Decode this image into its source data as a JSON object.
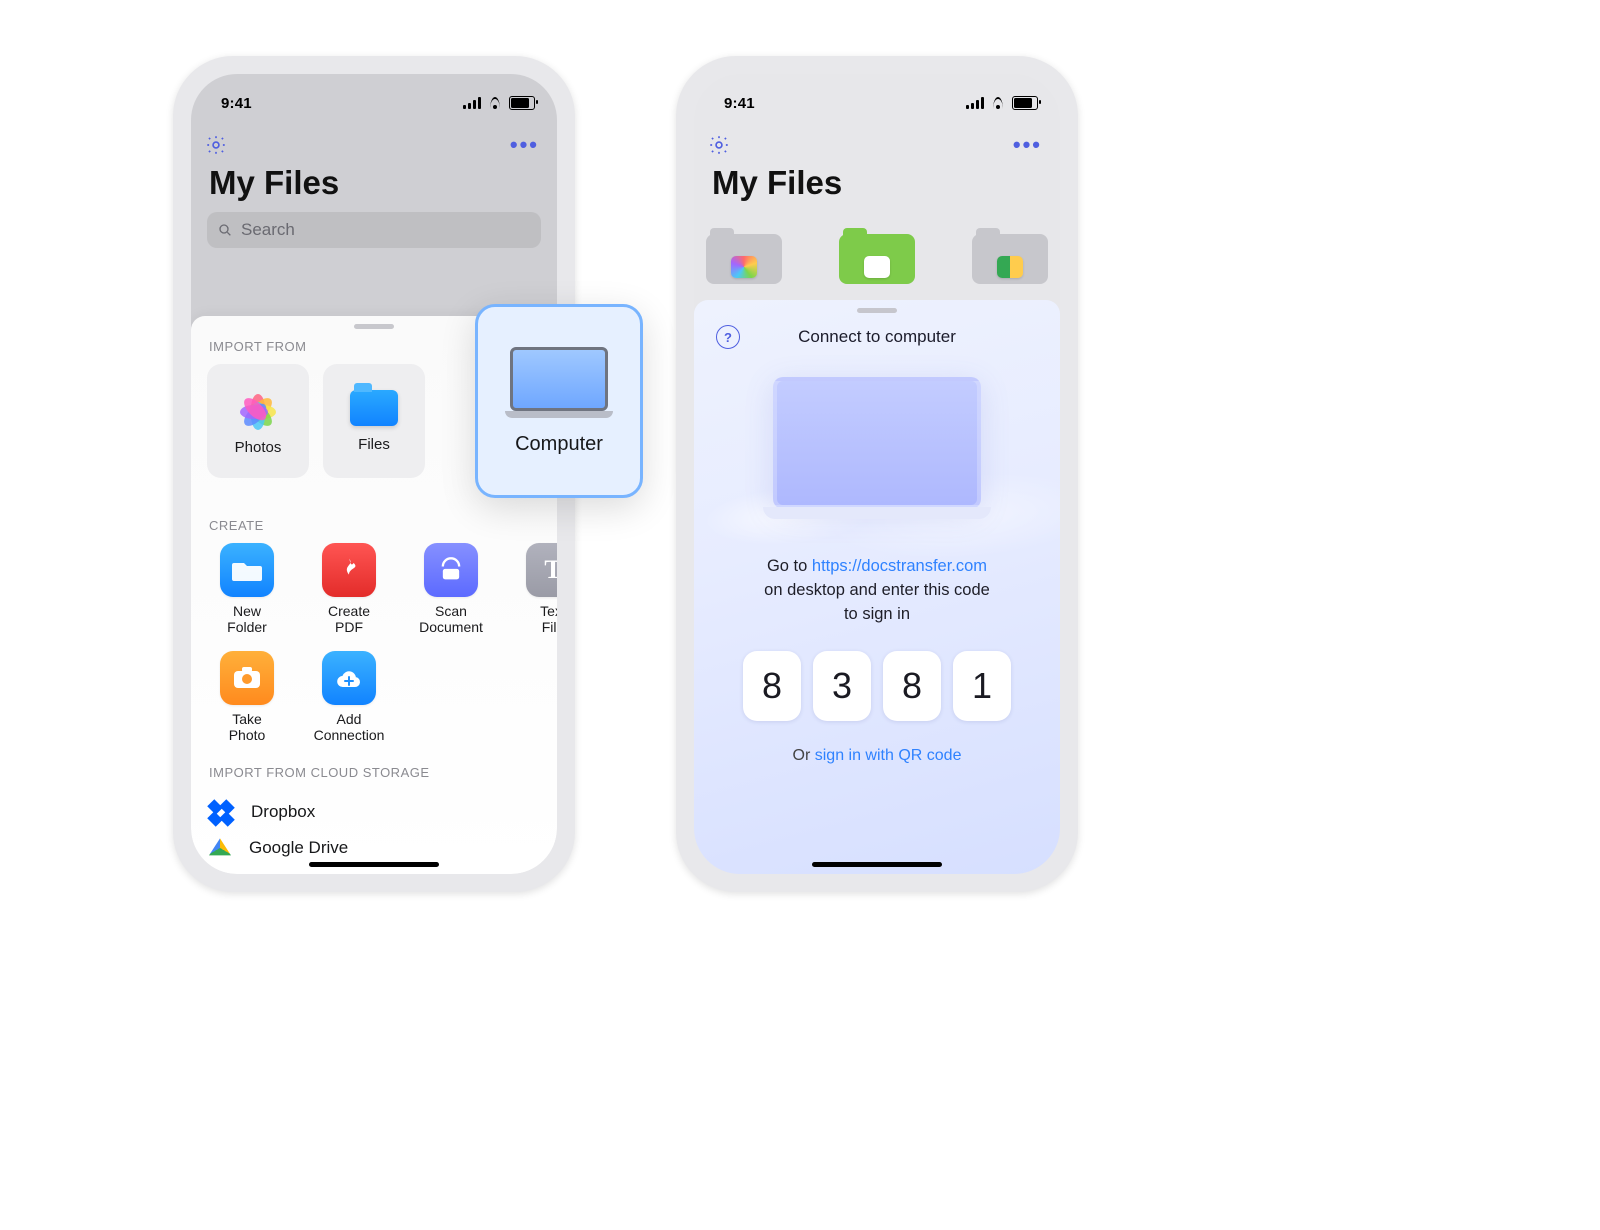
{
  "status": {
    "time": "9:41"
  },
  "header": {
    "title": "My Files",
    "search_placeholder": "Search"
  },
  "sheet_left": {
    "section_import": "IMPORT FROM",
    "card_photos": "Photos",
    "card_files": "Files",
    "card_computer": "Computer",
    "section_create": "CREATE",
    "create": {
      "new_folder": "New\nFolder",
      "create_pdf": "Create\nPDF",
      "scan_doc": "Scan\nDocument",
      "text_file": "Text\nFile",
      "take_photo": "Take\nPhoto",
      "add_conn": "Add\nConnection"
    },
    "section_cloud": "IMPORT FROM CLOUD STORAGE",
    "cloud_dropbox": "Dropbox",
    "cloud_gdrive": "Google Drive"
  },
  "sheet_right": {
    "title": "Connect to computer",
    "instruction_pre": "Go to ",
    "instruction_url": "https://docstransfer.com",
    "instruction_post1": " on desktop and enter this code",
    "instruction_post2": "to sign in",
    "code": [
      "8",
      "3",
      "8",
      "1"
    ],
    "alt_pre": "Or ",
    "alt_link": "sign in with QR code"
  }
}
